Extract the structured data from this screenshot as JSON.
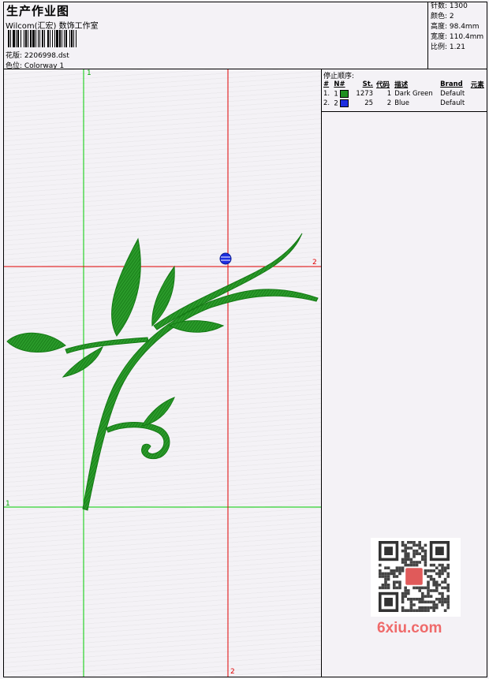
{
  "header": {
    "title": "生产作业图",
    "subtitle": "Wilcom(汇宏) 数饰工作室",
    "design_file": "花版: 2206998.dst",
    "colorway": "色位: Colorway 1"
  },
  "stats": {
    "stitches": "针数: 1300",
    "colors": "颜色: 2",
    "height": "高度: 98.4mm",
    "width": "宽度: 110.4mm",
    "scale": "比例: 1.21"
  },
  "stop_sequence": {
    "title": "停止顺序:",
    "headers": [
      "#",
      "N#",
      "St.",
      "代码",
      "描述",
      "Brand",
      "元素"
    ],
    "rows": [
      {
        "idx": "1.",
        "n": "1",
        "color": "#1f8f1f",
        "st": "1273",
        "code": "1",
        "desc": "Dark Green",
        "brand": "Default"
      },
      {
        "idx": "2.",
        "n": "2",
        "color": "#1d2ee0",
        "st": "25",
        "code": "2",
        "desc": "Blue",
        "brand": "Default"
      }
    ]
  },
  "axes": {
    "green_top": "1",
    "green_left": "1",
    "red_right": "2",
    "red_bottom": "2"
  },
  "colors": {
    "thread_green": "#1f8f1f",
    "thread_blue": "#1d2ee0",
    "guide_green": "#00cc00",
    "guide_red": "#e00000"
  },
  "watermark": {
    "site": "6xiu.com"
  }
}
